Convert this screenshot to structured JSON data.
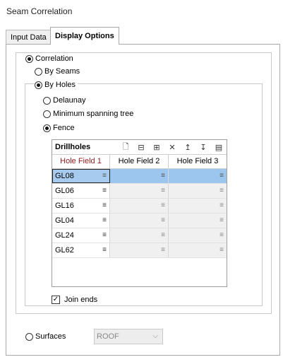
{
  "window": {
    "title": "Seam Correlation"
  },
  "tabs": [
    {
      "label": "Input Data",
      "active": false
    },
    {
      "label": "Display Options",
      "active": true
    }
  ],
  "options": {
    "correlation": {
      "label": "Correlation",
      "selected": true
    },
    "by_seams": {
      "label": "By Seams",
      "selected": false
    },
    "by_holes": {
      "label": "By Holes",
      "selected": true
    },
    "delaunay": {
      "label": "Delaunay",
      "selected": false
    },
    "minimum_spanning_tree": {
      "label": "Minimum spanning tree",
      "selected": false
    },
    "fence": {
      "label": "Fence",
      "selected": true
    },
    "surfaces": {
      "label": "Surfaces",
      "selected": false
    }
  },
  "grid": {
    "title": "Drillholes",
    "toolbar_icons": [
      "new-row-icon",
      "insert-row-icon",
      "append-row-icon",
      "delete-icon",
      "move-up-icon",
      "move-down-icon",
      "table-view-icon"
    ],
    "columns": [
      "Hole Field 1",
      "Hole Field 2",
      "Hole Field 3"
    ],
    "rows": [
      {
        "c1": "GL08",
        "c2": "",
        "c3": ""
      },
      {
        "c1": "GL06",
        "c2": "",
        "c3": ""
      },
      {
        "c1": "GL16",
        "c2": "",
        "c3": ""
      },
      {
        "c1": "GL04",
        "c2": "",
        "c3": ""
      },
      {
        "c1": "GL24",
        "c2": "",
        "c3": ""
      },
      {
        "c1": "GL62",
        "c2": "",
        "c3": ""
      }
    ],
    "selected_row": 0
  },
  "join_ends": {
    "label": "Join ends",
    "checked": true
  },
  "surface_select": {
    "value": "ROOF",
    "enabled": false
  },
  "glyphs": {
    "cell_menu": "≡",
    "check": "✓",
    "chevron": "⌵",
    "toolbar": [
      "🗋",
      "⊟",
      "⊞",
      "✕",
      "↥",
      "↧",
      "▤"
    ]
  }
}
